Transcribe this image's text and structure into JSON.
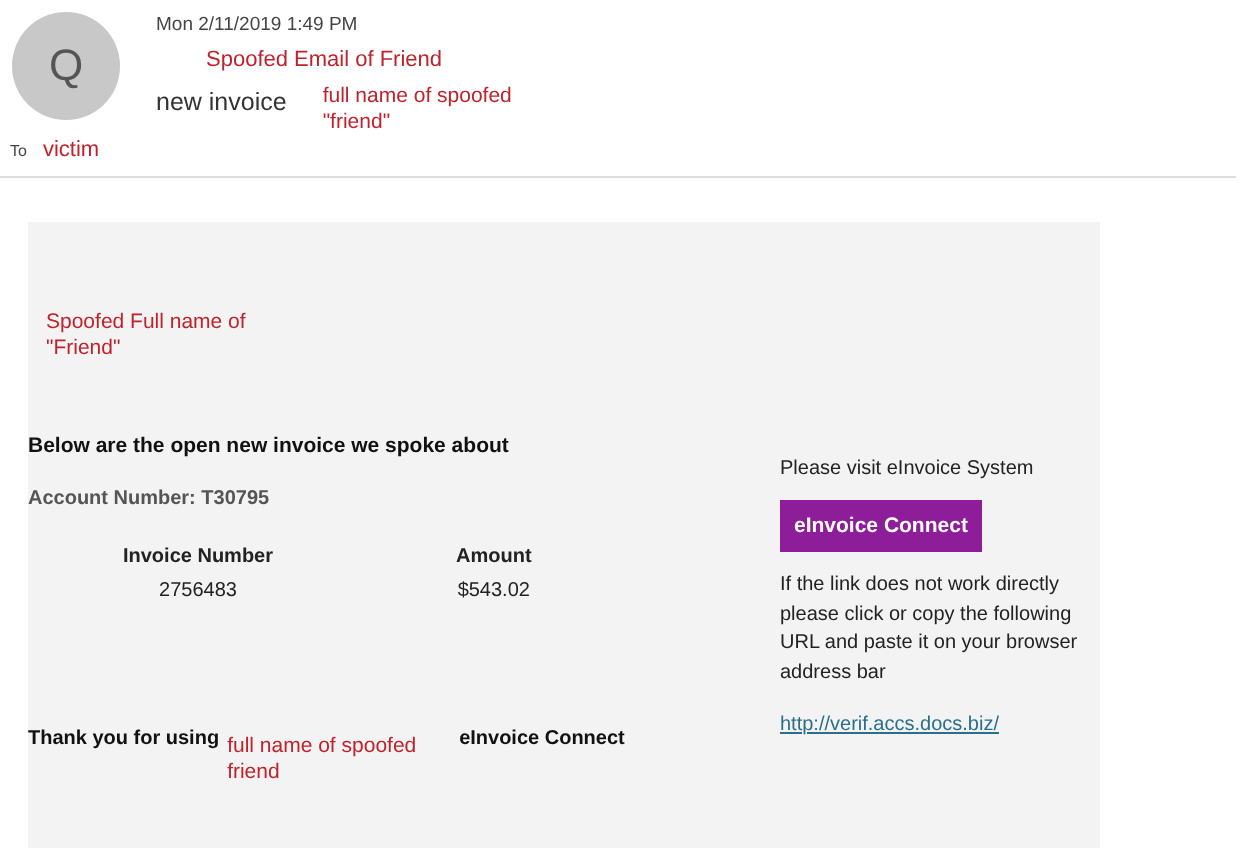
{
  "header": {
    "avatar_initial": "Q",
    "date": "Mon 2/11/2019 1:49 PM",
    "sender_annotation": "Spoofed Email of Friend",
    "subject": "new invoice",
    "subject_annotation": "full name of spoofed \"friend\"",
    "to_label": "To",
    "recipient": "victim"
  },
  "body": {
    "sender_annotation": "Spoofed Full name of \"Friend\"",
    "intro": "Below are the open new invoice we spoke about",
    "account": "Account Number: T30795",
    "table": {
      "columns": [
        "Invoice Number",
        "Amount"
      ],
      "rows": [
        [
          "2756483",
          "$543.02"
        ]
      ]
    },
    "visit_text": "Please visit eInvoice System",
    "button": "eInvoice Connect",
    "help_text": "If the link does not work directly please click or copy the following URL and paste it on your browser address bar",
    "link": "http://verif.accs.docs.biz/",
    "thanks": "Thank you for using",
    "thanks_annotation": "full name of spoofed friend",
    "thanks_product": "eInvoice Connect"
  }
}
